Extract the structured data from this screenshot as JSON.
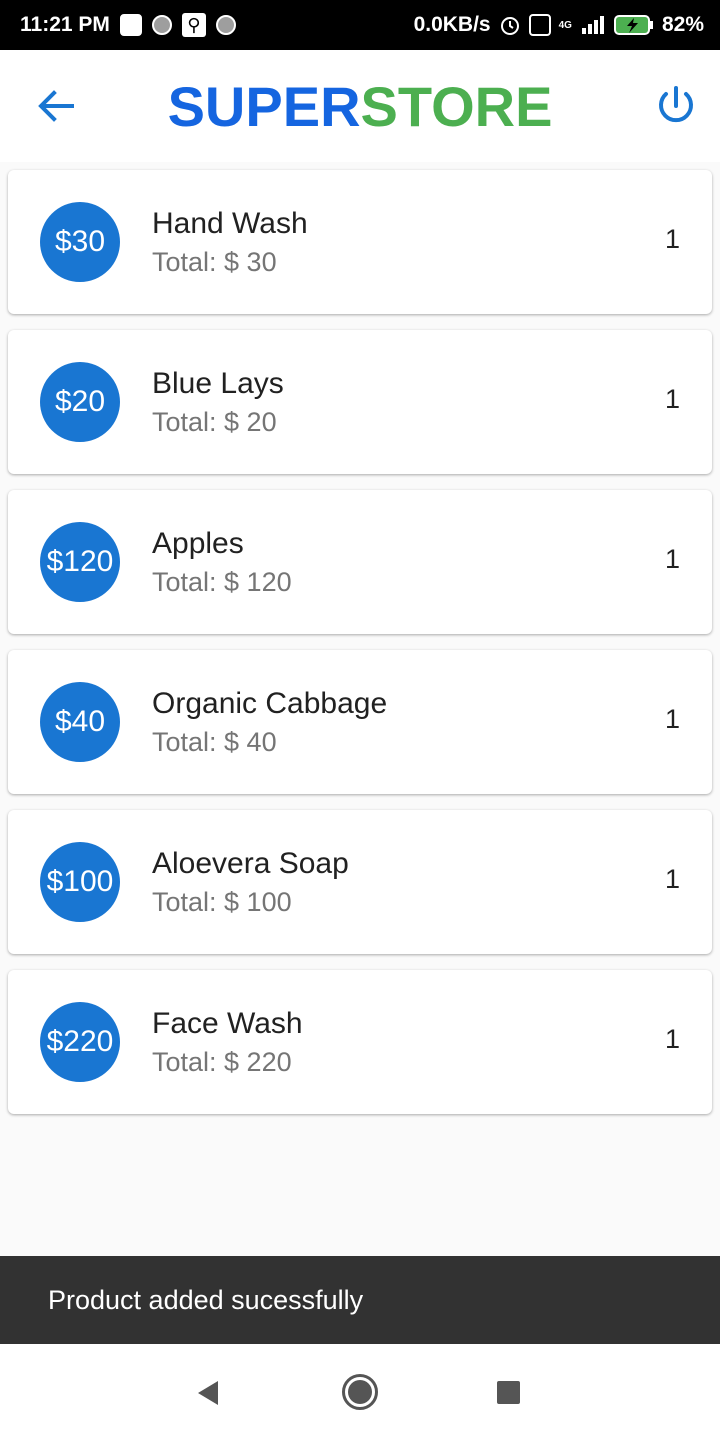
{
  "status": {
    "time": "11:21 PM",
    "speed": "0.0KB/s",
    "network": "4G",
    "battery": "82%"
  },
  "appbar": {
    "title_part1": "SUPER",
    "title_part2": "STORE",
    "title_part1_color": "#1565e0",
    "title_part2_color": "#4caf50",
    "back_icon": "arrow-left-icon",
    "power_icon": "power-icon"
  },
  "cart": {
    "items": [
      {
        "price_badge": "$30",
        "name": "Hand Wash",
        "total": "Total: $ 30",
        "qty": "1"
      },
      {
        "price_badge": "$20",
        "name": "Blue Lays",
        "total": "Total: $ 20",
        "qty": "1"
      },
      {
        "price_badge": "$120",
        "name": "Apples",
        "total": "Total: $ 120",
        "qty": "1"
      },
      {
        "price_badge": "$40",
        "name": "Organic Cabbage",
        "total": "Total: $ 40",
        "qty": "1"
      },
      {
        "price_badge": "$100",
        "name": "Aloevera Soap",
        "total": "Total: $ 100",
        "qty": "1"
      },
      {
        "price_badge": "$220",
        "name": "Face Wash",
        "total": "Total: $ 220",
        "qty": "1"
      }
    ]
  },
  "snackbar": {
    "message": "Product added sucessfully"
  },
  "colors": {
    "accent": "#1976d2",
    "snackbar_bg": "#323232"
  }
}
